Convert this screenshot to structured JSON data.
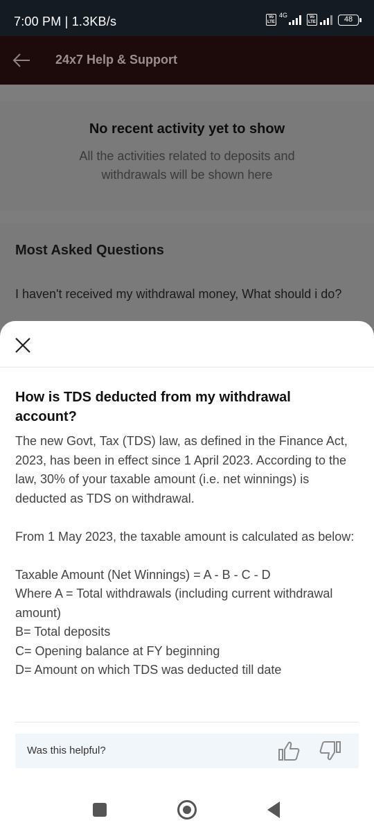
{
  "status_bar": {
    "time": "7:00 PM | 1.3KB/s",
    "network_label": "4G",
    "volte_label": "Vo LTE",
    "battery": "48"
  },
  "app_bar": {
    "title": "24x7 Help & Support",
    "icons": {
      "back": "arrow-left-icon"
    }
  },
  "recent_activity": {
    "heading": "No recent activity yet to show",
    "subtext": "All the activities related to deposits and withdrawals will be shown here"
  },
  "faq": {
    "heading": "Most Asked Questions",
    "first_question": "I haven't received my withdrawal money, What should i do?"
  },
  "sheet": {
    "icons": {
      "close": "close-icon",
      "like": "thumbs-up-icon",
      "dislike": "thumbs-down-icon"
    },
    "question": "How is TDS deducted from my withdrawal account?",
    "paragraph_1": "The new Govt, Tax (TDS) law, as defined in the Finance Act, 2023, has been in effect since 1 April 2023. According to the law, 30% of your taxable amount (i.e. net winnings) is deducted as TDS on withdrawal.",
    "paragraph_2": "From 1 May 2023, the taxable amount is calculated as below:",
    "formula_lines": [
      "Taxable Amount (Net Winnings) = A - B - C - D",
      "Where A = Total withdrawals (including current withdrawal amount)",
      "B= Total deposits",
      "C= Opening balance at FY beginning",
      "D= Amount on which TDS was deducted till date"
    ],
    "helpful_label": "Was this helpful?"
  },
  "nav_bar": {
    "icons": [
      "recents-square-icon",
      "home-circle-icon",
      "back-triangle-icon"
    ]
  },
  "colors": {
    "status_bar_bg": "#141b22",
    "app_bar_bg": "#1d0a0a",
    "overlay_bg": "#7a7a7a",
    "sheet_bg": "#ffffff",
    "helpful_bg": "#f1f6fb"
  }
}
